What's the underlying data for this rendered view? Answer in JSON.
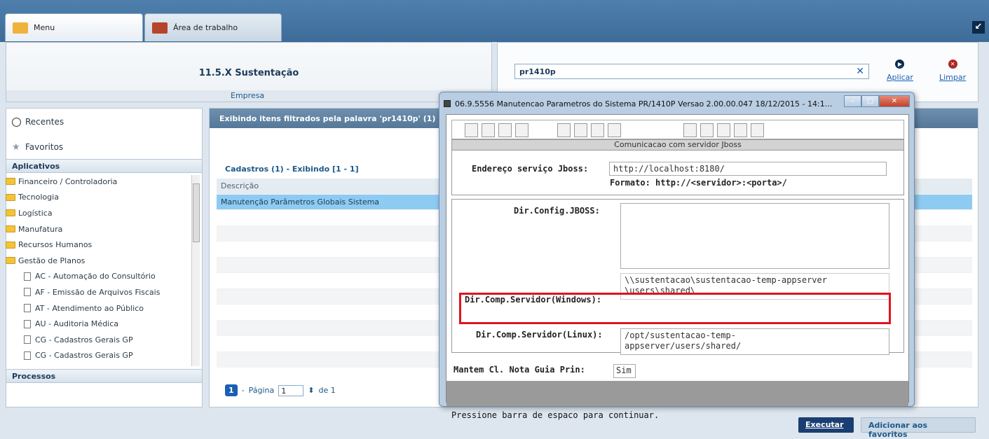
{
  "tabs": [
    {
      "label": "Menu"
    },
    {
      "label": "Área de trabalho"
    }
  ],
  "empresa": {
    "title": "11.5.X Sustentação",
    "label": "Empresa"
  },
  "search": {
    "value": "pr1410p",
    "apply_label": "Aplicar",
    "clear_label": "Limpar"
  },
  "sidebar": {
    "recentes": "Recentes",
    "favoritos": "Favoritos",
    "aplicativos": "Aplicativos",
    "processos": "Processos",
    "folders": [
      "Financeiro / Controladoria",
      "Tecnologia",
      "Logística",
      "Manufatura",
      "Recursos Humanos",
      "Gestão de Planos"
    ],
    "docs": [
      "AC - Automação do Consultório",
      "AF - Emissão de Arquivos Fiscais",
      "AT - Atendimento ao Público",
      "AU - Auditoria Médica",
      "CG - Cadastros Gerais GP",
      "CG - Cadastros Gerais GP"
    ]
  },
  "main": {
    "header": "Exibindo itens filtrados pela palavra 'pr1410p' (1)",
    "cadastros": "Cadastros (1) - Exibindo [1 - 1]",
    "column": "Descrição",
    "rows": [
      "Manutenção Parâmetros Globais Sistema"
    ],
    "pager": {
      "page_num": "1",
      "dash": "-",
      "pagina": "Página",
      "value": "1",
      "de": "de 1"
    }
  },
  "buttons": {
    "executar": "Executar",
    "favoritos": "Adicionar aos favoritos"
  },
  "dialog": {
    "title": "06.9.5556 Manutencao  Parametros do Sistema PR/1410P Versao 2.00.00.047 18/12/2015 - 14:1...",
    "section": "Comunicacao com servidor Jboss",
    "endereco_label": "Endereço serviço Jboss:",
    "endereco_value": "http://localhost:8180/",
    "formato": "Formato: http://<servidor>:<porta>/",
    "dirconfig_label": "Dir.Config.JBOSS:",
    "dirconfig_value": "",
    "dirwin_label": "Dir.Comp.Servidor(Windows):",
    "dirwin_value": "\\\\sustentacao\\sustentacao-temp-appserver\n\\users\\shared\\",
    "dirlinux_label": "Dir.Comp.Servidor(Linux):",
    "dirlinux_value": "/opt/sustentacao-temp-\nappserver/users/shared/",
    "mantem_label": "Mantem Cl. Nota Guia Prin:",
    "mantem_value": "Sim",
    "status": "Pressione barra de espaco para continuar."
  }
}
